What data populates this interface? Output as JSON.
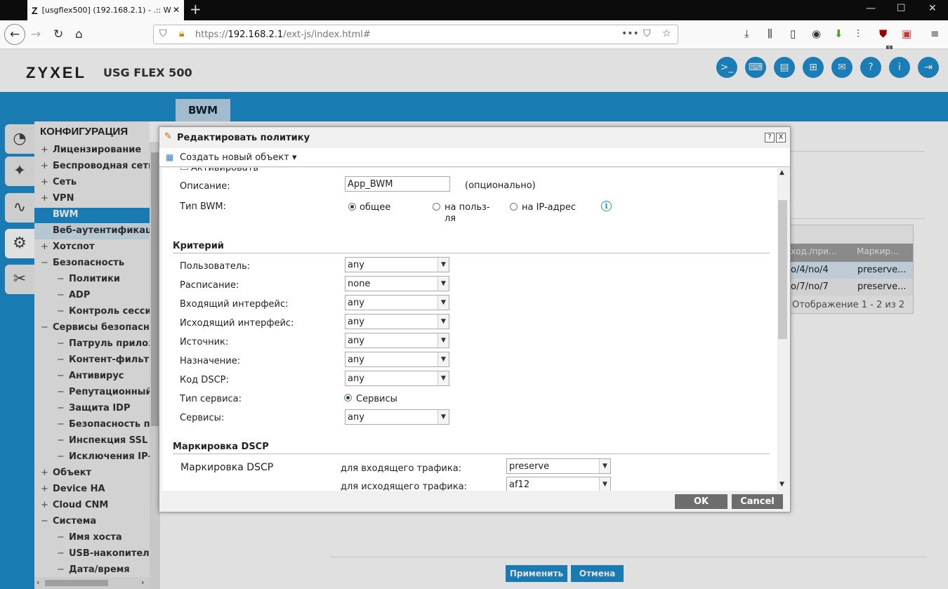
{
  "browser": {
    "tab_title": "[usgflex500] (192.168.2.1) - .:: W",
    "url_prefix": "https://",
    "url_host": "192.168.2.1",
    "url_path": "/ext-js/index.html#",
    "ublock_badge": "1"
  },
  "header": {
    "logo": "ZYXEL",
    "model": "USG FLEX 500"
  },
  "main_tab": "BWM",
  "sidebar": {
    "title": "КОНФИГУРАЦИЯ",
    "items": [
      {
        "label": "Лицензирование",
        "pm": "+"
      },
      {
        "label": "Беспроводная сеть",
        "pm": "+"
      },
      {
        "label": "Сеть",
        "pm": "+"
      },
      {
        "label": "VPN",
        "pm": "+"
      },
      {
        "label": "BWM",
        "pm": ""
      },
      {
        "label": "Веб-аутентификация",
        "pm": ""
      },
      {
        "label": "Хотспот",
        "pm": "+"
      },
      {
        "label": "Безопасность",
        "pm": "−"
      },
      {
        "label": "Политики",
        "pm": "−"
      },
      {
        "label": "ADP",
        "pm": "−"
      },
      {
        "label": "Контроль сессий",
        "pm": "−"
      },
      {
        "label": "Сервисы безопасности",
        "pm": "−"
      },
      {
        "label": "Патруль приложений",
        "pm": "−"
      },
      {
        "label": "Контент-фильтр",
        "pm": "−"
      },
      {
        "label": "Антивирус",
        "pm": "−"
      },
      {
        "label": "Репутационный",
        "pm": "−"
      },
      {
        "label": "Защита IDP",
        "pm": "−"
      },
      {
        "label": "Безопасность почты",
        "pm": "−"
      },
      {
        "label": "Инспекция SSL",
        "pm": "−"
      },
      {
        "label": "Исключения IP-адресов",
        "pm": "−"
      },
      {
        "label": "Объект",
        "pm": "+"
      },
      {
        "label": "Device HA",
        "pm": "+"
      },
      {
        "label": "Cloud CNM",
        "pm": "+"
      },
      {
        "label": "Система",
        "pm": "−"
      },
      {
        "label": "Имя хоста",
        "pm": "−"
      },
      {
        "label": "USB-накопитель",
        "pm": "−"
      },
      {
        "label": "Дата/время",
        "pm": "−"
      }
    ]
  },
  "background_table": {
    "col1": "ход./при...",
    "col2": "Маркир...",
    "rows": [
      [
        "o/4/no/4",
        "preserve..."
      ],
      [
        "o/7/no/7",
        "preserve..."
      ]
    ],
    "footer": "Отображение 1 - 2 из 2"
  },
  "bottom_buttons": {
    "apply": "Применить",
    "cancel": "Отмена"
  },
  "dialog": {
    "title": "Редактировать политику",
    "help": "?",
    "close": "X",
    "toolbar_create": "Создать новый объект",
    "activate_label": "Активировать",
    "description_label": "Описание:",
    "description_value": "App_BWM",
    "optional_hint": "(опционально)",
    "bwm_type_label": "Тип BWM:",
    "bwm_types": [
      "общее",
      "на польз-",
      "ля",
      "на IP-адрес"
    ],
    "criteria_title": "Критерий",
    "criteria": [
      {
        "label": "Пользователь:",
        "value": "any"
      },
      {
        "label": "Расписание:",
        "value": "none"
      },
      {
        "label": "Входящий интерфейс:",
        "value": "any"
      },
      {
        "label": "Исходящий интерфейс:",
        "value": "any"
      },
      {
        "label": "Источник:",
        "value": "any"
      },
      {
        "label": "Назначение:",
        "value": "any"
      },
      {
        "label": "Код DSCP:",
        "value": "any"
      }
    ],
    "service_type_label": "Тип сервиса:",
    "service_type_value": "Сервисы",
    "services_label": "Сервисы:",
    "services_value": "any",
    "dscp_title": "Маркировка DSCP",
    "dscp_label": "Маркировка DSCP",
    "dscp_in_label": "для входящего трафика:",
    "dscp_in_value": "preserve",
    "dscp_out_label": "для исходящего трафика:",
    "dscp_out_value": "af12",
    "ok": "OK",
    "cancel": "Cancel"
  }
}
